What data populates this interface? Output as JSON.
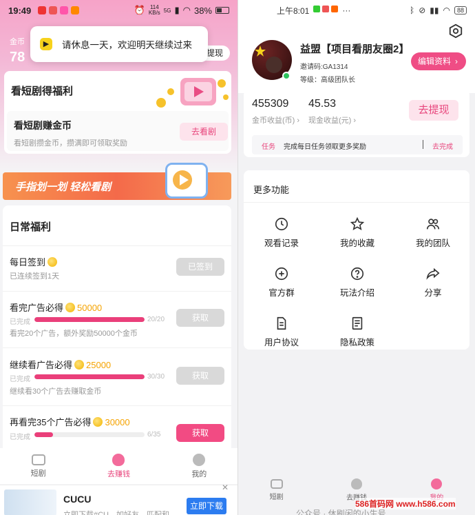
{
  "left": {
    "status": {
      "time": "19:49",
      "net_speed": "114",
      "net_unit": "KB/s",
      "signal": "5G",
      "battery": "38%"
    },
    "toast": {
      "text": "请休息一天，欢迎明天继续过来"
    },
    "header": {
      "coin_label": "金币",
      "coin_value_partial": "78",
      "button_partial": "提现"
    },
    "drama_card": {
      "title": "看短剧得福利",
      "sub_title": "看短剧赚金币",
      "desc": "看短剧攒金币，攒满即可领取奖励",
      "button": "去看剧"
    },
    "banner": {
      "text": "手指划一划 轻松看剧"
    },
    "daily": {
      "title": "日常福利",
      "items": [
        {
          "title": "每日签到",
          "desc": "已连续签到1天",
          "button": "已签到"
        },
        {
          "title": "看完广告必得",
          "reward": "50000",
          "status": "已完成",
          "progress_text": "20/20",
          "progress": 1.0,
          "desc": "看完20个广告，额外奖励50000个金币",
          "button": "获取"
        },
        {
          "title": "继续看广告必得",
          "reward": "25000",
          "status": "已完成",
          "progress_text": "30/30",
          "progress": 1.0,
          "desc": "继续看30个广告去赚取金币",
          "button": "获取"
        },
        {
          "title": "再看完35个广告必得",
          "reward": "30000",
          "status": "已完成",
          "progress_text": "6/35",
          "progress": 0.17,
          "button": "获取"
        }
      ]
    },
    "tabs": [
      {
        "label": "短剧",
        "icon": "tv-icon"
      },
      {
        "label": "去赚钱",
        "icon": "money-bag-icon"
      },
      {
        "label": "我的",
        "icon": "person-icon"
      }
    ],
    "ad": {
      "title": "CUCU",
      "desc": "立即下载#CU…如好友…匹配和",
      "button": "立即下载",
      "close": "✕"
    }
  },
  "right": {
    "status": {
      "time": "上午8:01",
      "battery": "88"
    },
    "profile": {
      "name": "益盟【项目看朋友圈2】",
      "invite_code": "邀请码:GA1314",
      "level": "等级：高级团队长",
      "edit_button": "编辑资料"
    },
    "earnings": {
      "coins": "455309",
      "coins_label": "金币收益(币)",
      "cash": "45.53",
      "cash_label": "现金收益(元)",
      "withdraw_button": "去提现"
    },
    "task": {
      "tag": "任务",
      "text": "完成每日任务领取更多奖励",
      "button": "去完成"
    },
    "more": {
      "title": "更多功能",
      "items": [
        {
          "label": "观看记录",
          "icon": "clock-icon"
        },
        {
          "label": "我的收藏",
          "icon": "star-icon"
        },
        {
          "label": "我的团队",
          "icon": "team-icon"
        },
        {
          "label": "官方群",
          "icon": "chat-plus-icon"
        },
        {
          "label": "玩法介绍",
          "icon": "question-icon"
        },
        {
          "label": "分享",
          "icon": "share-icon"
        },
        {
          "label": "用户协议",
          "icon": "document-icon"
        },
        {
          "label": "隐私政策",
          "icon": "policy-icon"
        }
      ]
    },
    "tabs": [
      {
        "label": "短剧",
        "icon": "tv-icon"
      },
      {
        "label": "去赚钱",
        "icon": "money-bag-icon"
      },
      {
        "label": "我的",
        "icon": "person-icon"
      }
    ],
    "watermark": {
      "site": "586首码网 www.h586.com",
      "account": "公众号 · 休刷闲的小生号"
    }
  }
}
